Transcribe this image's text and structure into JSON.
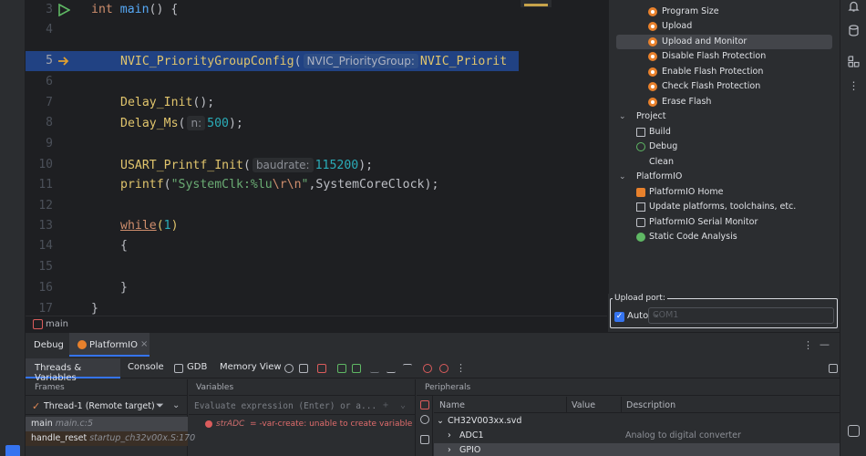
{
  "editor": {
    "lines": [
      {
        "num": "3"
      },
      {
        "num": "4"
      },
      {
        "num": "5"
      },
      {
        "num": "6"
      },
      {
        "num": "7"
      },
      {
        "num": "8"
      },
      {
        "num": "9"
      },
      {
        "num": "10"
      },
      {
        "num": "11"
      },
      {
        "num": "12"
      },
      {
        "num": "13"
      },
      {
        "num": "14"
      },
      {
        "num": "15"
      },
      {
        "num": "16"
      },
      {
        "num": "17"
      }
    ],
    "tokens": {
      "int": "int",
      "main": "main",
      "main_rest": "() {",
      "nvic": "NVIC_PriorityGroupConfig",
      "paren_open": "(",
      "nvic_hint": "NVIC_PriorityGroup:",
      "nvic_arg": "NVIC_Priorit",
      "delay_init": "Delay_Init",
      "delay_init_rest": "();",
      "delay_ms": "Delay_Ms",
      "delay_ms_hint": "n:",
      "delay_ms_arg": "500",
      "delay_ms_rest": ");",
      "usart": "USART_Printf_Init",
      "usart_hint": "baudrate:",
      "usart_arg": "115200",
      "usart_rest": ");",
      "printf": "printf",
      "printf_open": "(",
      "printf_str1": "\"SystemClk:%lu",
      "printf_esc": "\\r\\n",
      "printf_str2": "\"",
      "printf_rest": ",SystemCoreClock);",
      "while": "while",
      "while_open": "(",
      "while_arg": "1",
      "while_close": ")",
      "brace_open": "{",
      "brace_close": "}",
      "brace_final": "}"
    }
  },
  "breadcrumb": {
    "label": "main"
  },
  "platformio_panel": {
    "items": [
      {
        "label": "Program Size",
        "icon": "platformio-icon"
      },
      {
        "label": "Upload",
        "icon": "platformio-icon"
      },
      {
        "label": "Upload and Monitor",
        "icon": "platformio-icon",
        "selected": true
      },
      {
        "label": "Disable Flash Protection",
        "icon": "platformio-icon"
      },
      {
        "label": "Enable Flash Protection",
        "icon": "platformio-icon"
      },
      {
        "label": "Check Flash Protection",
        "icon": "platformio-icon"
      },
      {
        "label": "Erase Flash",
        "icon": "platformio-icon"
      }
    ],
    "project_group": {
      "label": "Project",
      "items": [
        {
          "label": "Build",
          "icon": "build-icon"
        },
        {
          "label": "Debug",
          "icon": "debug-icon"
        },
        {
          "label": "Clean",
          "icon": "none"
        }
      ]
    },
    "platformio_group": {
      "label": "PlatformIO",
      "items": [
        {
          "label": "PlatformIO Home",
          "icon": "home-icon"
        },
        {
          "label": "Update platforms, toolchains, etc.",
          "icon": "update-icon"
        },
        {
          "label": "PlatformIO Serial Monitor",
          "icon": "serial-icon"
        },
        {
          "label": "Static Code Analysis",
          "icon": "analysis-icon"
        }
      ]
    }
  },
  "upload_port": {
    "legend": "Upload port:",
    "auto_label": "Auto",
    "auto_checked": true,
    "port_value": "COM1"
  },
  "debug_panel": {
    "title": "Debug",
    "session_tab": "PlatformIO",
    "toolbar_tabs": {
      "threads": "Threads & Variables",
      "console": "Console",
      "gdb": "GDB",
      "memory": "Memory View"
    },
    "frames": {
      "header": "Frames",
      "thread": "Thread-1 (Remote target)",
      "rows": [
        {
          "name": "main",
          "location": "main.c:5"
        },
        {
          "name": "handle_reset",
          "location": "startup_ch32v00x.S:170"
        }
      ]
    },
    "variables": {
      "header": "Variables",
      "eval_placeholder": "Evaluate expression (Enter) or a...",
      "row_name": "strADC",
      "row_message": "= -var-create: unable to create variable obj"
    },
    "peripherals": {
      "header": "Peripherals",
      "columns": {
        "name": "Name",
        "value": "Value",
        "description": "Description"
      },
      "rows": [
        {
          "name": "CH32V003xx.svd",
          "description": ""
        },
        {
          "name": "ADC1",
          "description": "Analog to digital converter"
        },
        {
          "name": "GPIO",
          "description": ""
        }
      ]
    }
  },
  "colors": {
    "accent": "#3574f0",
    "selection": "#214283",
    "platformio_orange": "#e8812c"
  }
}
